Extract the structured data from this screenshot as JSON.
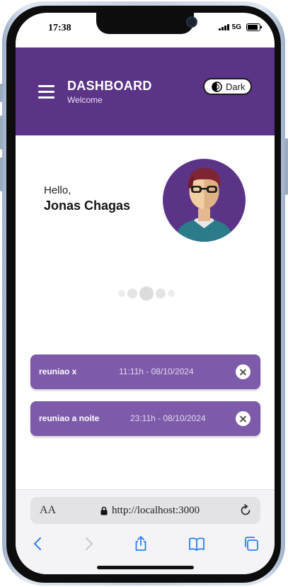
{
  "status_bar": {
    "time": "17:38",
    "network": "5G",
    "battery_level": 0.85
  },
  "header": {
    "title": "DASHBOARD",
    "subtitle": "Welcome",
    "theme_toggle_label": "Dark",
    "background_color": "#5b3487"
  },
  "greeting": {
    "hello": "Hello,",
    "user_name": "Jonas Chagas"
  },
  "meetings": [
    {
      "title": "reuniao x",
      "time": "11:11h - 08/10/2024"
    },
    {
      "title": "reuniao a noite",
      "time": "23:11h - 08/10/2024"
    }
  ],
  "browser": {
    "text_size_label": "AA",
    "url": "http://localhost:3000",
    "icons": [
      "back-icon",
      "forward-icon",
      "share-icon",
      "bookmarks-icon",
      "tabs-icon"
    ]
  },
  "colors": {
    "card": "#7d5aaa",
    "accent_blue": "#2f7cf6"
  }
}
